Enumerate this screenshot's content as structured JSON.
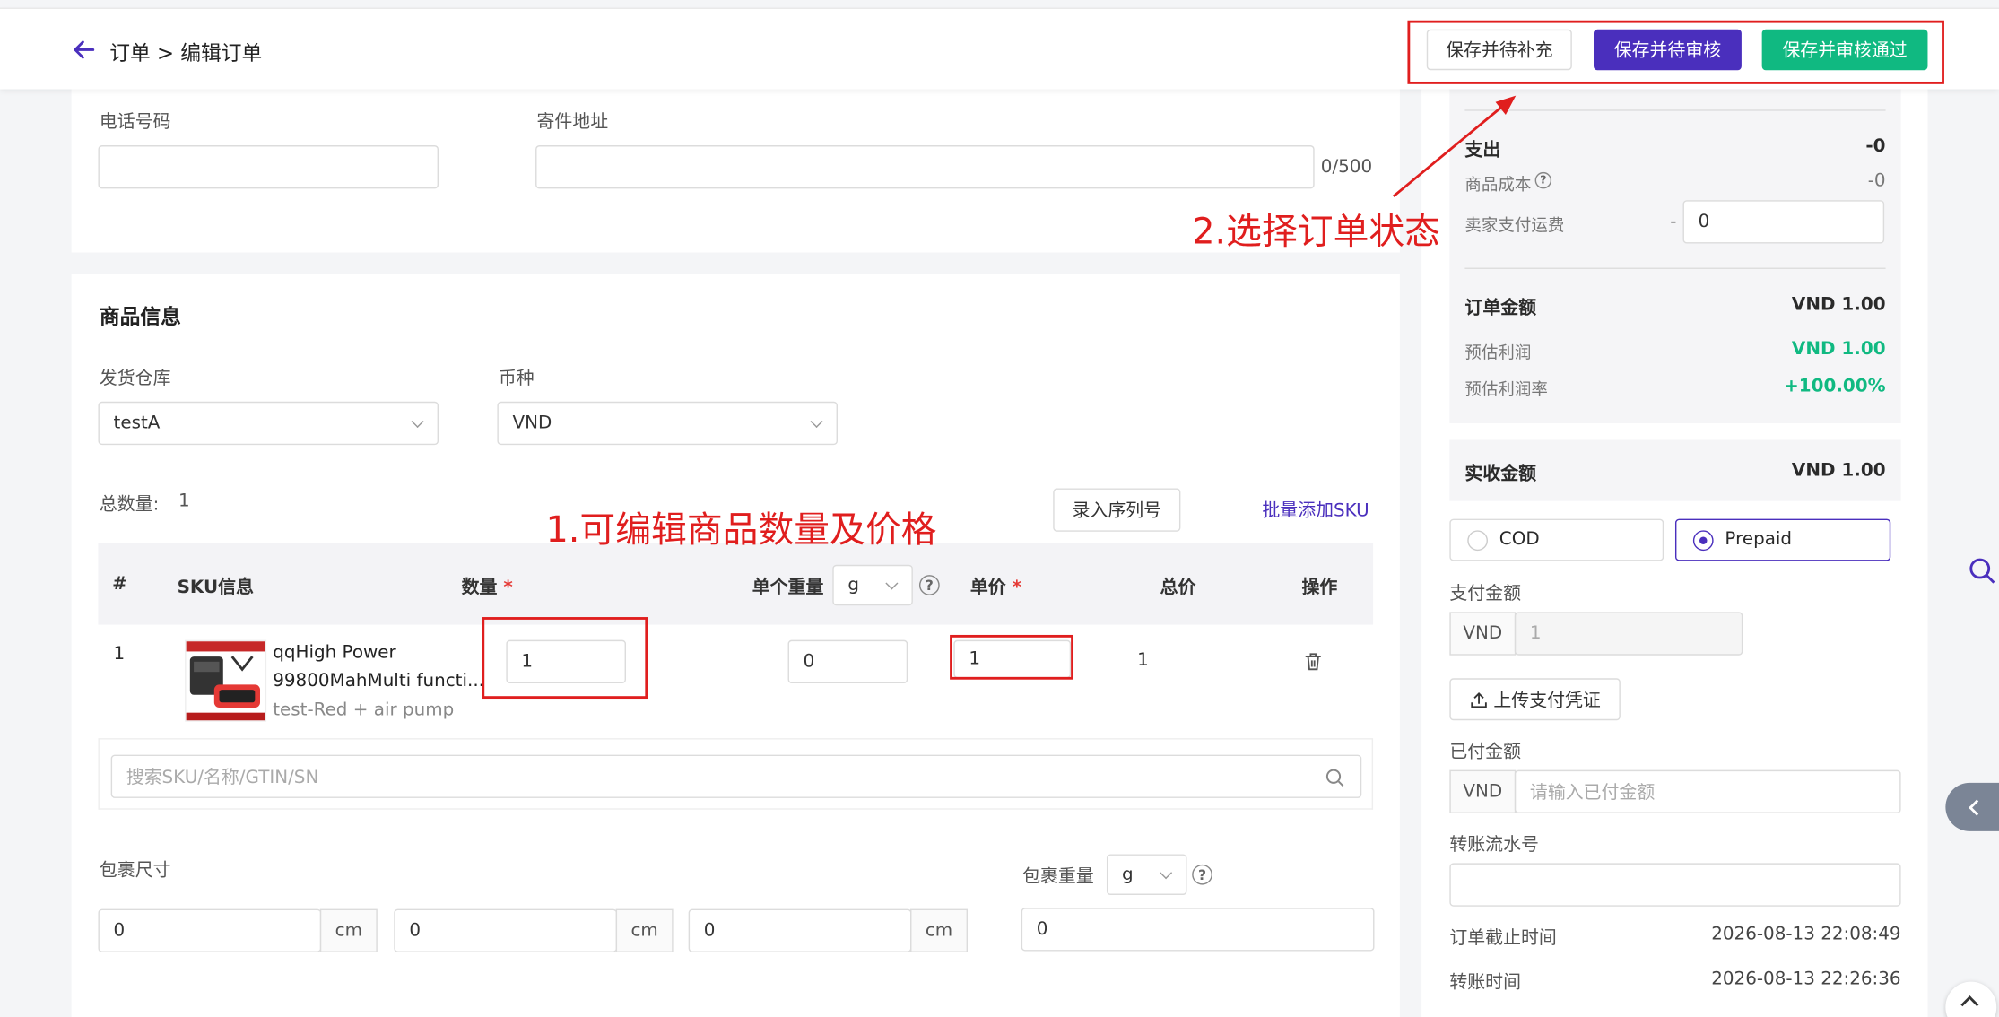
{
  "header": {
    "breadcrumb": "订单 > 编辑订单",
    "btn_supplement": "保存并待补充",
    "btn_pending_review": "保存并待审核",
    "btn_approve": "保存并审核通过"
  },
  "contact": {
    "phone_label": "电话号码",
    "phone_value": "",
    "address_label": "寄件地址",
    "address_value": "",
    "address_counter": "0/500"
  },
  "goods": {
    "title": "商品信息",
    "warehouse_label": "发货仓库",
    "warehouse_value": "testA",
    "currency_label": "币种",
    "currency_value": "VND",
    "total_qty_label": "总数量:",
    "total_qty_value": "1",
    "serial_btn": "录入序列号",
    "batch_add_link": "批量添加SKU",
    "columns": {
      "index": "#",
      "sku": "SKU信息",
      "qty": "数量",
      "weight": "单个重量",
      "weight_unit": "g",
      "price": "单价",
      "total": "总价",
      "action": "操作"
    },
    "rows": [
      {
        "index": "1",
        "name_line1": "qqHigh Power",
        "name_line2": "99800MahMulti functi...",
        "variant": "test-Red + air pump",
        "qty": "1",
        "weight": "0",
        "price": "1",
        "total": "1"
      }
    ],
    "search_placeholder": "搜索SKU/名称/GTIN/SN"
  },
  "package": {
    "size_label": "包裹尺寸",
    "dims": [
      "0",
      "0",
      "0"
    ],
    "dim_unit": "cm",
    "weight_label": "包裹重量",
    "weight_unit": "g",
    "weight_value": "0"
  },
  "summary": {
    "expense_label": "支出",
    "expense_value": "-0",
    "cost_label": "商品成本",
    "cost_value": "-0",
    "shipping_label": "卖家支付运费",
    "shipping_prefix": "-",
    "shipping_value": "0",
    "order_amount_label": "订单金额",
    "order_amount_value": "VND 1.00",
    "est_profit_label": "预估利润",
    "est_profit_value": "VND 1.00",
    "est_margin_label": "预估利润率",
    "est_margin_value": "+100.00%",
    "received_label": "实收金额",
    "received_value": "VND 1.00"
  },
  "payment": {
    "options": [
      "COD",
      "Prepaid"
    ],
    "selected": "Prepaid",
    "pay_amount_label": "支付金额",
    "pay_currency": "VND",
    "pay_amount_value": "1",
    "upload_btn": "上传支付凭证",
    "paid_label": "已付金额",
    "paid_currency": "VND",
    "paid_placeholder": "请输入已付金额",
    "transfer_no_label": "转账流水号",
    "transfer_no_value": "",
    "deadline_label": "订单截止时间",
    "deadline_value": "2026-08-13 22:08:49",
    "transfer_time_label": "转账时间",
    "transfer_time_value": "2026-08-13 22:26:36"
  },
  "annotations": {
    "step1": "1.可编辑商品数量及价格",
    "step2": "2.选择订单状态"
  },
  "colors": {
    "primary": "#4a2fbd",
    "success": "#10b981",
    "annotation": "#e01e1e"
  }
}
